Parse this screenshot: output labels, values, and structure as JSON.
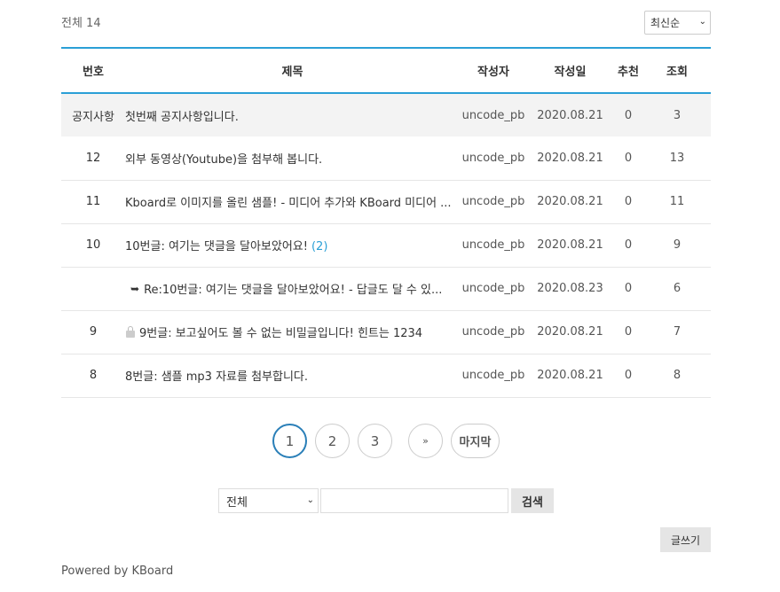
{
  "board": {
    "total_label": "전체 14",
    "sort": {
      "selected": "최신순"
    },
    "columns": {
      "num": "번호",
      "title": "제목",
      "writer": "작성자",
      "date": "작성일",
      "vote": "추천",
      "view": "조회"
    },
    "rows": [
      {
        "num": "공지사항",
        "title": "첫번째 공지사항입니다.",
        "writer": "uncode_pb",
        "date": "2020.08.21",
        "vote": "0",
        "view": "3"
      },
      {
        "num": "12",
        "title": "외부 동영상(Youtube)을 첨부해 봅니다.",
        "writer": "uncode_pb",
        "date": "2020.08.21",
        "vote": "0",
        "view": "13"
      },
      {
        "num": "11",
        "title": "Kboard로 이미지를 올린 샘플! - 미디어 추가와 KBoard 미디어 ...",
        "writer": "uncode_pb",
        "date": "2020.08.21",
        "vote": "0",
        "view": "11"
      },
      {
        "num": "10",
        "title": "10번글: 여기는 댓글을 달아보았어요!",
        "comments": "(2)",
        "writer": "uncode_pb",
        "date": "2020.08.21",
        "vote": "0",
        "view": "9"
      },
      {
        "num": "",
        "title": "Re:10번글: 여기는 댓글을 달아보았어요! - 답글도 달 수 있...",
        "writer": "uncode_pb",
        "date": "2020.08.23",
        "vote": "0",
        "view": "6"
      },
      {
        "num": "9",
        "title": "9번글: 보고싶어도 볼 수 없는 비밀글입니다! 힌트는 1234",
        "writer": "uncode_pb",
        "date": "2020.08.21",
        "vote": "0",
        "view": "7"
      },
      {
        "num": "8",
        "title": "8번글: 샘플 mp3 자료를 첨부합니다.",
        "writer": "uncode_pb",
        "date": "2020.08.21",
        "vote": "0",
        "view": "8"
      }
    ]
  },
  "pagination": {
    "pages": [
      "1",
      "2",
      "3"
    ],
    "next": "»",
    "last": "마지막",
    "current": "1"
  },
  "search": {
    "field_selected": "전체",
    "query": "",
    "button": "검색"
  },
  "write_button": "글쓰기",
  "footer": {
    "powered_by": "Powered by KBoard"
  },
  "icons": {
    "reply": "reply-arrow-icon",
    "lock": "lock-icon",
    "dropdown": "chevron-down-icon"
  },
  "colors": {
    "accent": "#2a9fd6",
    "notice_bg": "#f3f3f3",
    "button_bg": "#e5e5e5"
  }
}
